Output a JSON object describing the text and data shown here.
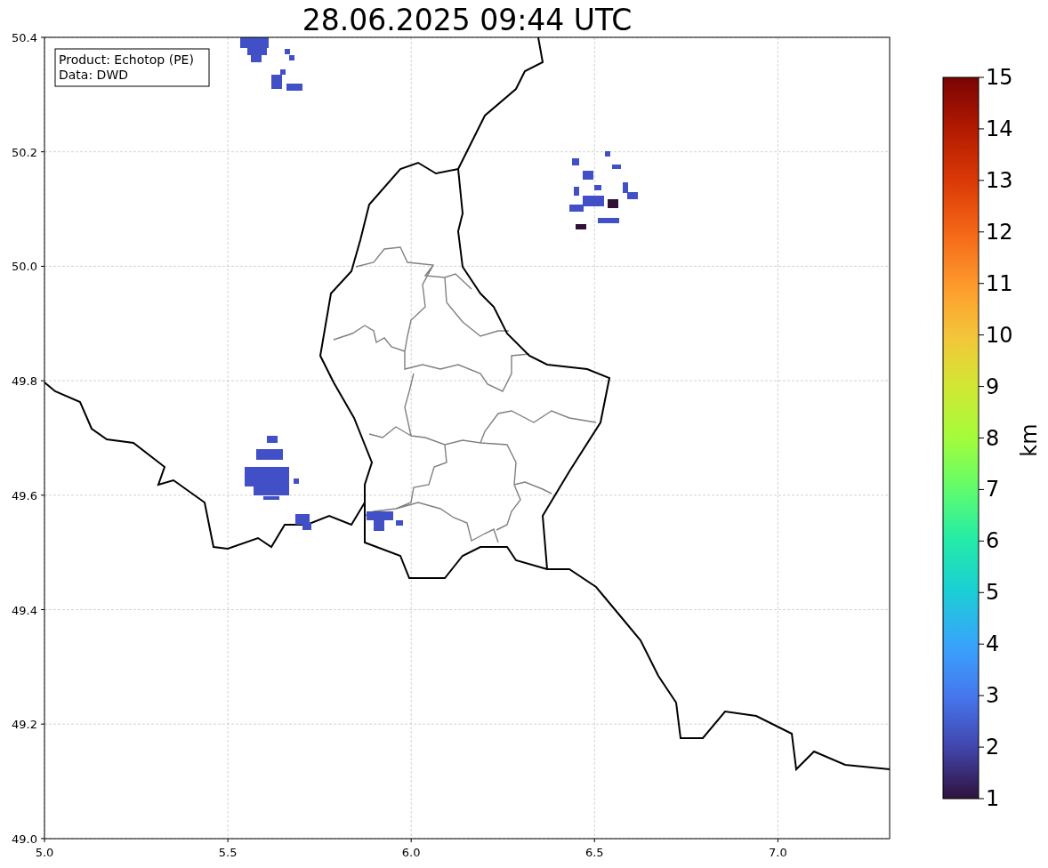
{
  "title": "28.06.2025 09:44 UTC",
  "info_box": {
    "lines": [
      "Product: Echotop (PE)",
      "Data: DWD"
    ]
  },
  "x_axis": {
    "ticks": [
      "5.0",
      "5.5",
      "6.0",
      "6.5",
      "7.0"
    ]
  },
  "y_axis": {
    "ticks": [
      "50.4",
      "50.2",
      "50.0",
      "49.8",
      "49.6",
      "49.4",
      "49.2",
      "49.0"
    ]
  },
  "colorbar": {
    "label": "km",
    "ticks": [
      "15",
      "14",
      "13",
      "12",
      "11",
      "10",
      "9",
      "8",
      "7",
      "6",
      "5",
      "4",
      "3",
      "2",
      "1"
    ]
  }
}
